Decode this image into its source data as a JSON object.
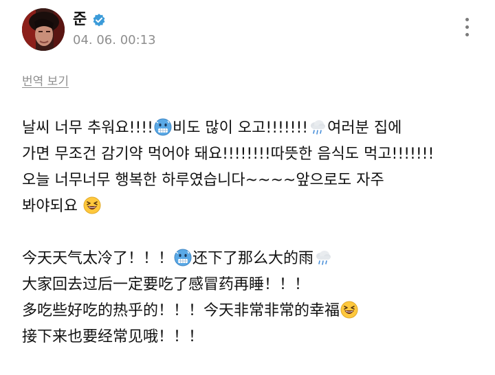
{
  "post": {
    "author": {
      "name": "준",
      "verified": true,
      "verified_color": "#3b9bd9"
    },
    "timestamp": "04. 06. 00:13",
    "translate_label": "번역 보기",
    "korean": {
      "line1_a": "날씨 너무 추워요!!!!",
      "line1_b": "비도 많이 오고!!!!!!!",
      "line1_c": "여러분 집에",
      "line2": "가면 무조건 감기약 먹어야 돼요!!!!!!!!따뜻한 음식도 먹고!!!!!!!",
      "line3": "오늘 너무너무 행복한 하루였습니다~~~~앞으로도 자주",
      "line4": "봐야되요 "
    },
    "chinese": {
      "line1_a": "今天天气太冷了！！！",
      "line1_b": "还下了那么大的雨",
      "line2": "大家回去过后一定要吃了感冒药再睡！！！",
      "line3": "多吃些好吃的热乎的！！！今天非常非常的幸福",
      "line4": "接下来也要经常见哦！！！"
    },
    "emojis": [
      "freezing-face-emoji",
      "rain-cloud-emoji",
      "laughing-face-emoji"
    ]
  }
}
